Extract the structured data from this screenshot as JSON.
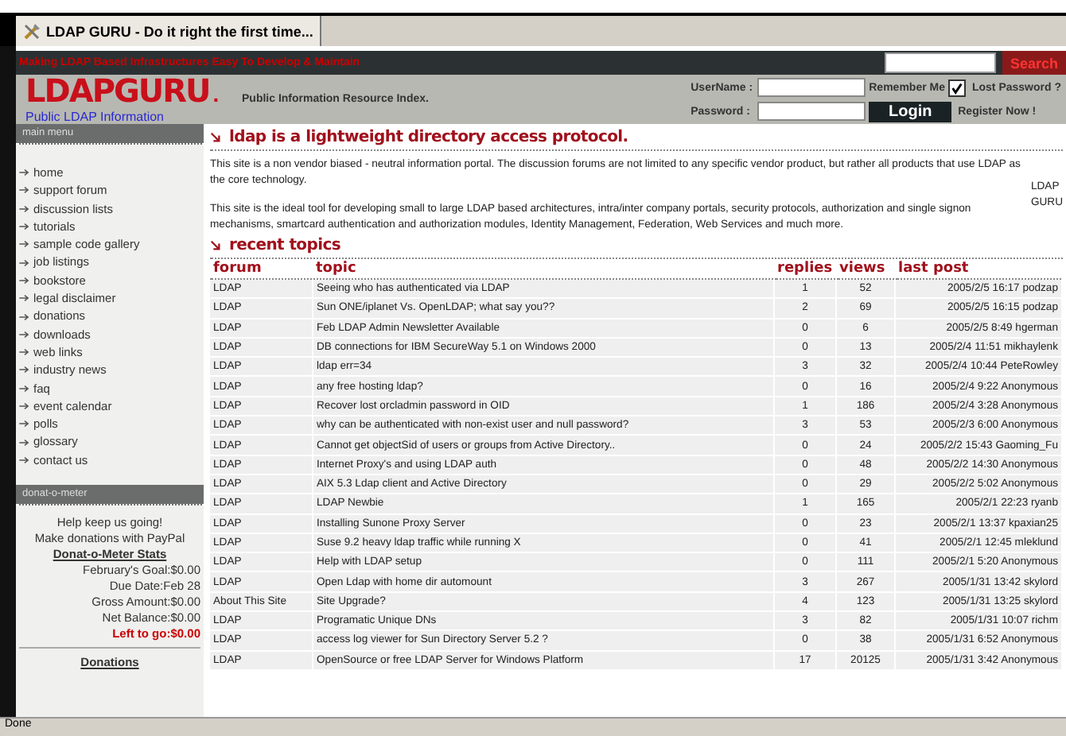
{
  "tab": {
    "title": "LDAP GURU - Do it right the first time..."
  },
  "topbar": {
    "tagline": "Making LDAP Based Infrastructures Easy To Develop & Maintain",
    "search_button": "Search"
  },
  "header": {
    "logo": "LDAPGURU",
    "logo_dot": ".",
    "logo_sub": "Public LDAP Information",
    "slogan": "Public Information Resource Index.",
    "username_label": "UserName :",
    "password_label": "Password :",
    "remember_label": "Remember Me",
    "remember_checked": true,
    "login_button": "Login",
    "lost_password": "Lost Password ?",
    "register": "Register Now !"
  },
  "sidebar": {
    "menu_title": "main menu",
    "items": [
      "home",
      "support forum",
      "discussion lists",
      "tutorials",
      "sample code gallery",
      "job listings",
      "bookstore",
      "legal disclaimer",
      "donations",
      "downloads",
      "web links",
      "industry news",
      "faq",
      "event calendar",
      "polls",
      "glossary",
      "contact us"
    ],
    "meter_title": "donat-o-meter",
    "meter_lines": [
      "Help keep us going!",
      "Make donations with PayPal"
    ],
    "meter_stats": "Donat-o-Meter Stats",
    "stats": [
      "February's Goal:$0.00",
      "Due Date:Feb 28",
      "Gross Amount:$0.00",
      "Net Balance:$0.00"
    ],
    "left": "Left to go:$0.00",
    "donations_link": "Donations"
  },
  "intro": {
    "title": "ldap is a lightweight directory access protocol.",
    "paragraphs": [
      "This site is a non vendor biased - neutral information portal. The discussion forums are not limited to any specific vendor product, but rather all products that use LDAP as the core technology.",
      "This site is the ideal tool for developing small to large LDAP based architectures, intra/inter company portals, security protocols, authorization and single signon mechanisms, smartcard authentication and authorization modules, Identity Management, Federation, Web Services and much more."
    ],
    "side_text": [
      "LDAP",
      "GURU"
    ]
  },
  "recent": {
    "title": "recent topics",
    "columns": [
      "forum",
      "topic",
      "replies",
      "views",
      "last post"
    ],
    "rows": [
      [
        "LDAP",
        "Seeing who has authenticated via LDAP",
        "1",
        "52",
        "2005/2/5 16:17 podzap"
      ],
      [
        "LDAP",
        "Sun ONE/iplanet Vs. OpenLDAP; what say you??",
        "2",
        "69",
        "2005/2/5 16:15 podzap"
      ],
      [
        "LDAP",
        "Feb LDAP Admin Newsletter Available",
        "0",
        "6",
        "2005/2/5 8:49 hgerman"
      ],
      [
        "LDAP",
        "DB connections for IBM SecureWay 5.1 on Windows 2000",
        "0",
        "13",
        "2005/2/4 11:51 mikhaylenk"
      ],
      [
        "LDAP",
        "ldap err=34",
        "3",
        "32",
        "2005/2/4 10:44 PeteRowley"
      ],
      [
        "LDAP",
        "any free hosting ldap?",
        "0",
        "16",
        "2005/2/4 9:22 Anonymous"
      ],
      [
        "LDAP",
        "Recover lost orcladmin password in OID",
        "1",
        "186",
        "2005/2/4 3:28 Anonymous"
      ],
      [
        "LDAP",
        "why can be authenticated with non-exist user and null password?",
        "3",
        "53",
        "2005/2/3 6:00 Anonymous"
      ],
      [
        "LDAP",
        "Cannot get objectSid of users or groups from Active Directory..",
        "0",
        "24",
        "2005/2/2 15:43 Gaoming_Fu"
      ],
      [
        "LDAP",
        "Internet Proxy's and using LDAP auth",
        "0",
        "48",
        "2005/2/2 14:30 Anonymous"
      ],
      [
        "LDAP",
        "AIX 5.3 Ldap client and Active Directory",
        "0",
        "29",
        "2005/2/2 5:02 Anonymous"
      ],
      [
        "LDAP",
        "LDAP Newbie",
        "1",
        "165",
        "2005/2/1 22:23 ryanb"
      ],
      [
        "LDAP",
        "Installing Sunone Proxy Server",
        "0",
        "23",
        "2005/2/1 13:37 kpaxian25"
      ],
      [
        "LDAP",
        "Suse 9.2 heavy ldap traffic while running X",
        "0",
        "41",
        "2005/2/1 12:45 mleklund"
      ],
      [
        "LDAP",
        "Help with LDAP setup",
        "0",
        "111",
        "2005/2/1 5:20 Anonymous"
      ],
      [
        "LDAP",
        "Open Ldap with home dir automount",
        "3",
        "267",
        "2005/1/31 13:42 skylord"
      ],
      [
        "About This Site",
        "Site Upgrade?",
        "4",
        "123",
        "2005/1/31 13:25 skylord"
      ],
      [
        "LDAP",
        "Programatic Unique DNs",
        "3",
        "82",
        "2005/1/31 10:07 richm"
      ],
      [
        "LDAP",
        "access log viewer for Sun Directory Server 5.2 ?",
        "0",
        "38",
        "2005/1/31 6:52 Anonymous"
      ],
      [
        "LDAP",
        "OpenSource or free LDAP Server for Windows Platform",
        "17",
        "20125",
        "2005/1/31 3:42 Anonymous"
      ]
    ]
  },
  "status_bar": "Done"
}
